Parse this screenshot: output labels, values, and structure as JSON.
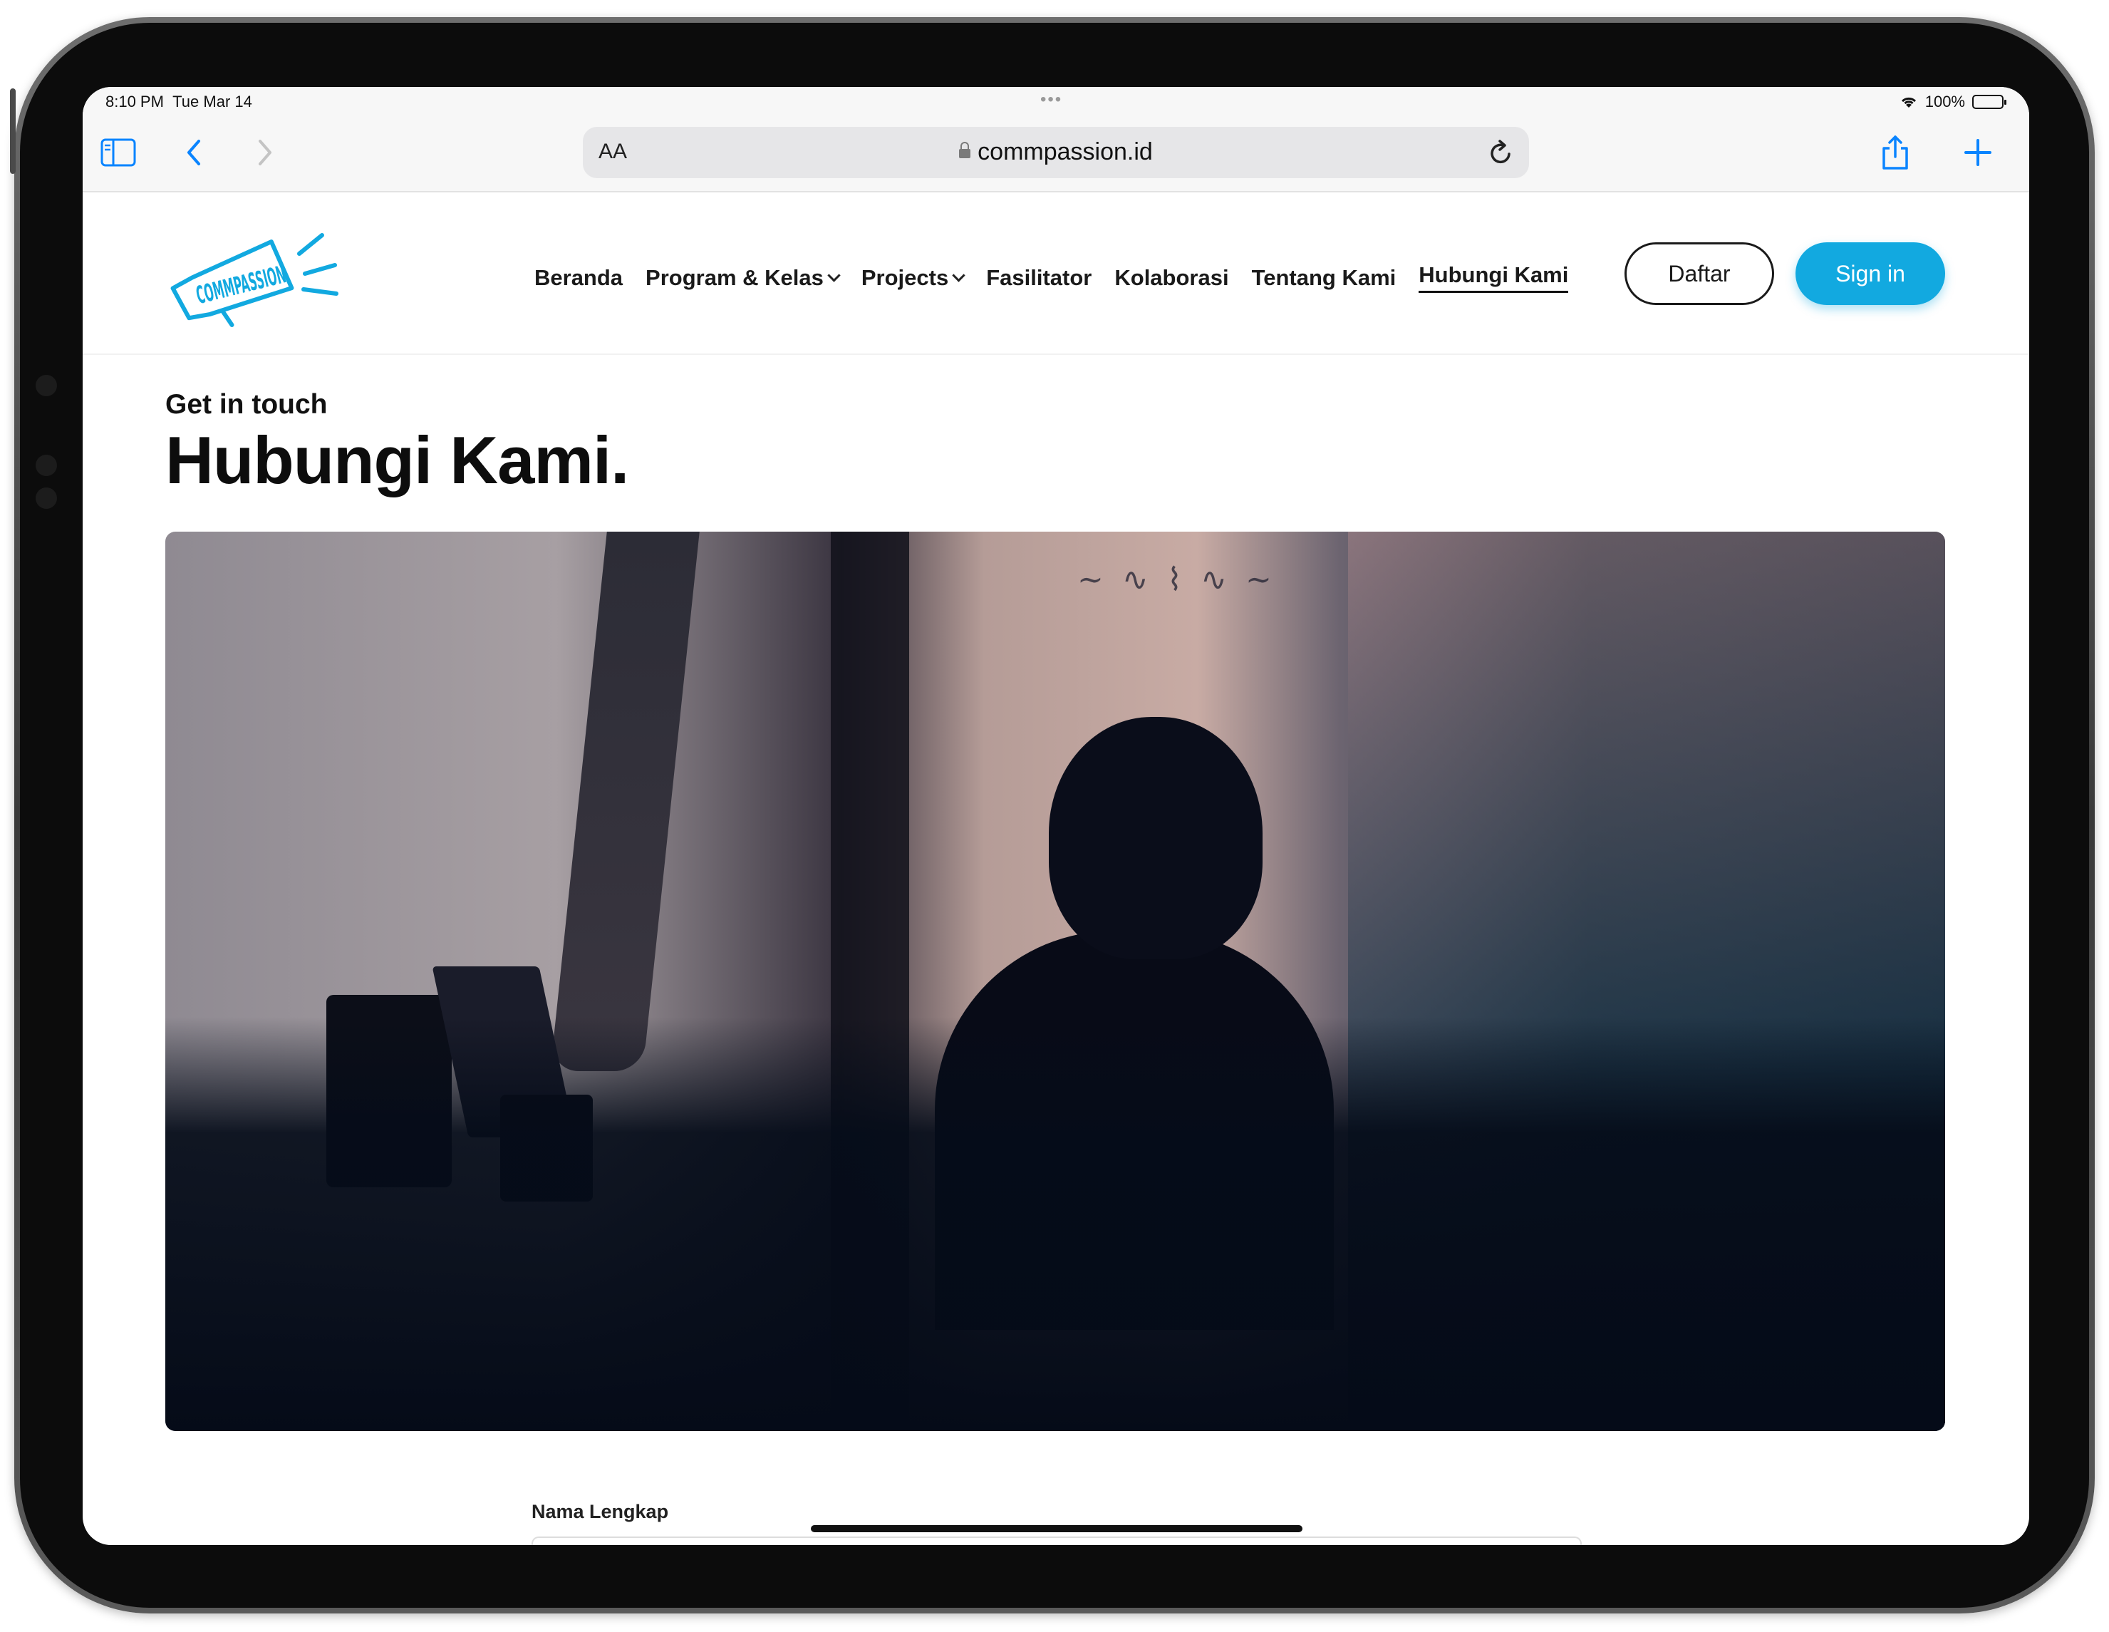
{
  "status_bar": {
    "time": "8:10 PM",
    "date": "Tue Mar 14",
    "battery": "100%"
  },
  "browser": {
    "text_size_label": "AA",
    "url": "commpassion.id"
  },
  "site": {
    "logo_text": "COMMPASSION",
    "brand_color": "#12a9e0",
    "nav": [
      {
        "label": "Beranda",
        "dropdown": false
      },
      {
        "label": "Program & Kelas",
        "dropdown": true
      },
      {
        "label": "Projects",
        "dropdown": true
      },
      {
        "label": "Fasilitator",
        "dropdown": false
      },
      {
        "label": "Kolaborasi",
        "dropdown": false
      },
      {
        "label": "Tentang Kami",
        "dropdown": false
      },
      {
        "label": "Hubungi Kami",
        "dropdown": false,
        "active": true
      }
    ],
    "daftar_label": "Daftar",
    "signin_label": "Sign in"
  },
  "page": {
    "eyebrow": "Get in touch",
    "title": "Hubungi Kami.",
    "form": {
      "name_label": "Nama Lengkap"
    }
  }
}
